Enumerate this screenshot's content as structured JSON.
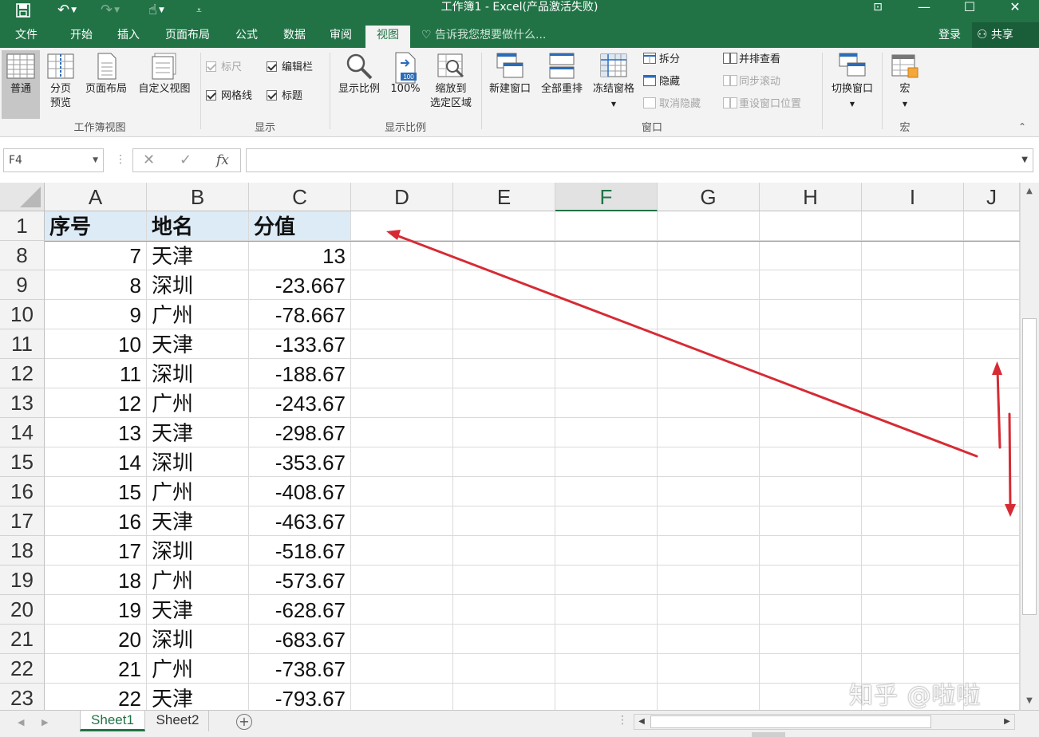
{
  "window": {
    "title": "工作簿1 - Excel(产品激活失败)",
    "min_glyph": "—",
    "max_glyph": "☐",
    "close_glyph": "✕",
    "ribbon_display_glyph": "⊡"
  },
  "ribbon_tabs": [
    "文件",
    "开始",
    "插入",
    "页面布局",
    "公式",
    "数据",
    "审阅",
    "视图"
  ],
  "active_tab": "视图",
  "tell_me": "告诉我您想要做什么...",
  "account": {
    "login": "登录",
    "share": "共享"
  },
  "ribbon": {
    "workbook_views": {
      "label": "工作簿视图",
      "normal": "普通",
      "page_break": [
        "分页",
        "预览"
      ],
      "page_layout": "页面布局",
      "custom_views": "自定义视图"
    },
    "show": {
      "label": "显示",
      "ruler": "标尺",
      "formula_bar": "编辑栏",
      "gridlines": "网格线",
      "headings": "标题"
    },
    "zoom": {
      "label": "显示比例",
      "zoom": "显示比例",
      "hundred": "100%",
      "hundred_icon_text": "100",
      "zoom_selection": [
        "缩放到",
        "选定区域"
      ]
    },
    "window": {
      "label": "窗口",
      "new_window": "新建窗口",
      "arrange_all": "全部重排",
      "freeze_panes": "冻结窗格",
      "split": "拆分",
      "hide": "隐藏",
      "unhide": "取消隐藏",
      "side_by_side": "并排查看",
      "sync_scroll": "同步滚动",
      "reset_position": "重设窗口位置",
      "switch_windows": "切换窗口"
    },
    "macros": {
      "label": "宏",
      "macros": "宏"
    }
  },
  "formula_bar": {
    "name_box": "F4",
    "cancel": "✕",
    "enter": "✓",
    "fx": "fx",
    "value": ""
  },
  "columns": [
    "A",
    "B",
    "C",
    "D",
    "E",
    "F",
    "G",
    "H",
    "I",
    "J"
  ],
  "selected_column": "F",
  "header_row": {
    "row": "1",
    "cells": [
      "序号",
      "地名",
      "分值"
    ]
  },
  "rows": [
    {
      "row": "8",
      "a": "7",
      "b": "天津",
      "c": "13"
    },
    {
      "row": "9",
      "a": "8",
      "b": "深圳",
      "c": "-23.667"
    },
    {
      "row": "10",
      "a": "9",
      "b": "广州",
      "c": "-78.667"
    },
    {
      "row": "11",
      "a": "10",
      "b": "天津",
      "c": "-133.67"
    },
    {
      "row": "12",
      "a": "11",
      "b": "深圳",
      "c": "-188.67"
    },
    {
      "row": "13",
      "a": "12",
      "b": "广州",
      "c": "-243.67"
    },
    {
      "row": "14",
      "a": "13",
      "b": "天津",
      "c": "-298.67"
    },
    {
      "row": "15",
      "a": "14",
      "b": "深圳",
      "c": "-353.67"
    },
    {
      "row": "16",
      "a": "15",
      "b": "广州",
      "c": "-408.67"
    },
    {
      "row": "17",
      "a": "16",
      "b": "天津",
      "c": "-463.67"
    },
    {
      "row": "18",
      "a": "17",
      "b": "深圳",
      "c": "-518.67"
    },
    {
      "row": "19",
      "a": "18",
      "b": "广州",
      "c": "-573.67"
    },
    {
      "row": "20",
      "a": "19",
      "b": "天津",
      "c": "-628.67"
    },
    {
      "row": "21",
      "a": "20",
      "b": "深圳",
      "c": "-683.67"
    },
    {
      "row": "22",
      "a": "21",
      "b": "广州",
      "c": "-738.67"
    },
    {
      "row": "23",
      "a": "22",
      "b": "天津",
      "c": "-793.67"
    }
  ],
  "sheets": [
    "Sheet1",
    "Sheet2"
  ],
  "active_sheet": "Sheet1",
  "add_sheet": "+",
  "watermark": "知乎 @啦啦",
  "colors": {
    "excel_green": "#217346",
    "header_fill": "#ddebf7",
    "annotation_red": "#d62b34"
  }
}
